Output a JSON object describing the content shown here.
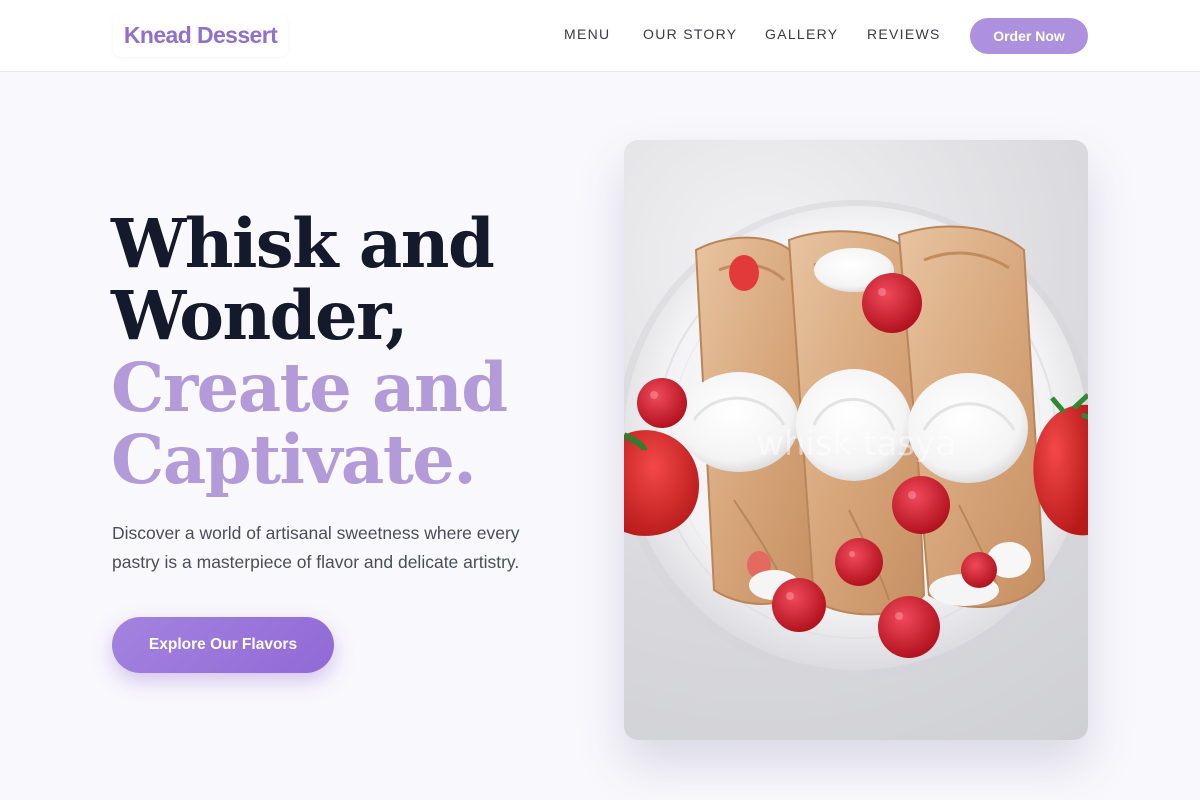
{
  "header": {
    "logo": "Knead Dessert",
    "nav": [
      {
        "label": "MENU"
      },
      {
        "label": "OUR STORY"
      },
      {
        "label": "GALLERY"
      },
      {
        "label": "REVIEWS"
      }
    ],
    "order_button": "Order Now"
  },
  "hero": {
    "headline_line1": "Whisk and",
    "headline_line2": "Wonder,",
    "headline_accent_line1": "Create and",
    "headline_accent_line2": "Captivate.",
    "lead": "Discover a world of artisanal sweetness where every pastry is a masterpiece of flavor and delicate artistry.",
    "cta": "Explore Our Flavors",
    "image": {
      "subject": "crepes-with-whipped-cream-and-berries",
      "watermark": "whisk tasya"
    }
  },
  "colors": {
    "brand": "#9070cf",
    "accent_text": "#b39ad9",
    "button": "#9169d6",
    "heading": "#141a2b",
    "background": "#f9f8fd"
  }
}
